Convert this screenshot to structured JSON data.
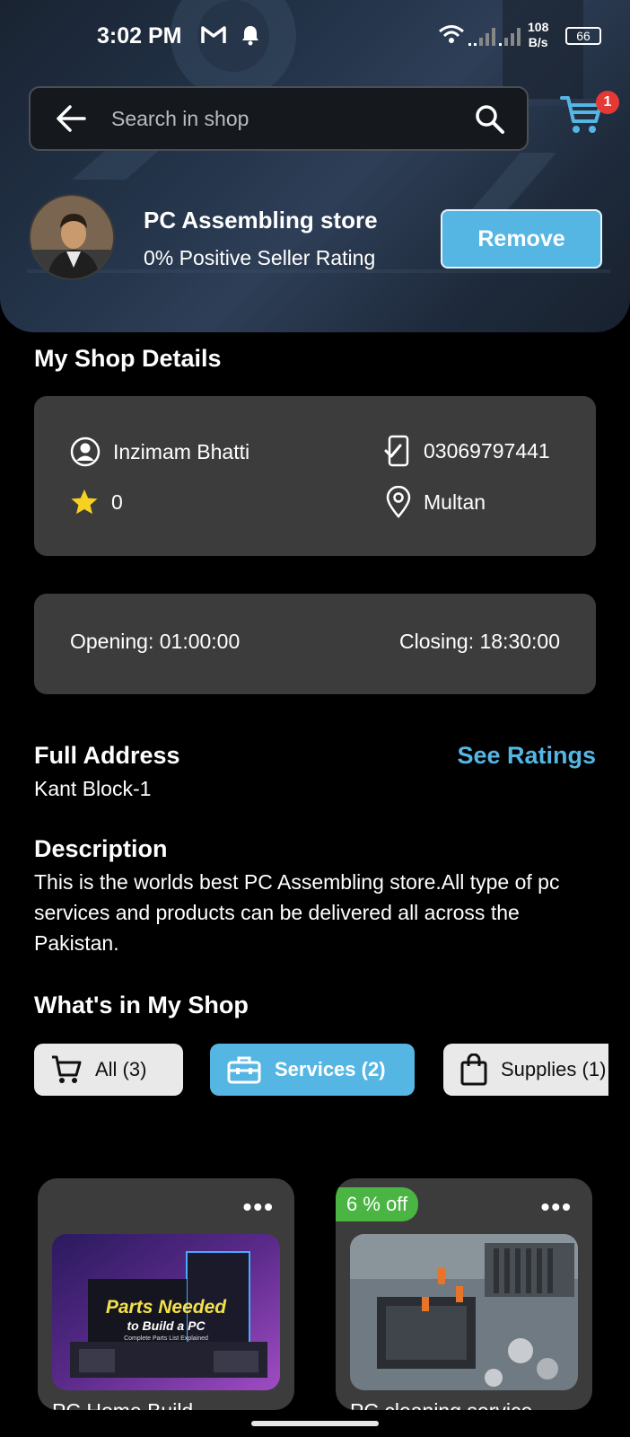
{
  "status_bar": {
    "time": "3:02 PM",
    "net_speed_value": "108",
    "net_speed_unit": "B/s",
    "battery": "66"
  },
  "search": {
    "placeholder": "Search in shop"
  },
  "cart": {
    "count": "1"
  },
  "store": {
    "name": "PC Assembling store",
    "rating_text": "0% Positive Seller Rating",
    "remove_label": "Remove"
  },
  "shop_details": {
    "title": "My Shop Details",
    "owner": "Inzimam Bhatti",
    "phone": "03069797441",
    "rating": "0",
    "city": "Multan",
    "opening": "Opening: 01:00:00",
    "closing": "Closing: 18:30:00"
  },
  "address": {
    "title": "Full Address",
    "value": "Kant Block-1",
    "see_ratings": "See Ratings"
  },
  "description": {
    "title": "Description",
    "value": "This is the worlds best PC Assembling store.All type of pc services and products can be delivered all across the Pakistan."
  },
  "shop_items": {
    "title": "What's in My Shop",
    "chips": [
      {
        "label": "All (3)",
        "icon": "cart-icon"
      },
      {
        "label": "Services (2)",
        "icon": "toolbox-icon"
      },
      {
        "label": "Supplies (1)",
        "icon": "bag-icon"
      }
    ]
  },
  "products": [
    {
      "name": "PC Home Build",
      "image_title": "Parts Needed",
      "image_subtitle": "to Build a PC",
      "image_caption": "Complete Parts List Explained"
    },
    {
      "name": "PC cleaning service",
      "discount": "6 % off"
    }
  ],
  "colors": {
    "accent": "#55b6e4",
    "card_bg": "#3c3c3c",
    "discount_green": "#4bb543",
    "badge_red": "#e53935"
  }
}
